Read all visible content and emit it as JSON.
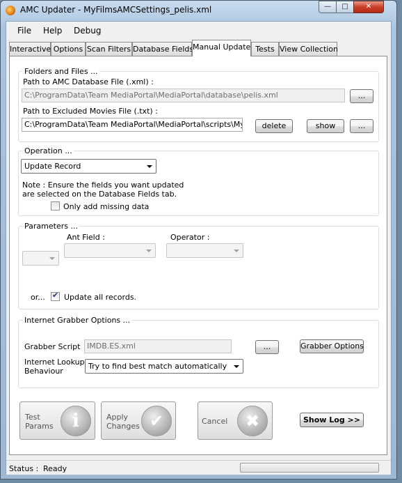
{
  "window": {
    "title": "AMC Updater - MyFilmsAMCSettings_pelis.xml",
    "controls": {
      "minimize": "—",
      "maximize": "□",
      "close": "✕"
    }
  },
  "menu": [
    "File",
    "Help",
    "Debug"
  ],
  "tabs": [
    "Interactive",
    "Options",
    "Scan Filters",
    "Database Fields",
    "Manual Update",
    "Tests",
    "View Collection"
  ],
  "active_tab": "Manual Update",
  "folders": {
    "title": "Folders and Files ...",
    "db_label": "Path to AMC Database File (.xml) :",
    "db_value": "C:\\ProgramData\\Team MediaPortal\\MediaPortal\\database\\pelis.xml",
    "db_browse": "...",
    "excluded_label": "Path to Excluded Movies File (.txt) :",
    "excluded_value": "C:\\ProgramData\\Team MediaPortal\\MediaPortal\\scripts\\MyFilms\\",
    "delete": "delete",
    "show": "show",
    "excluded_browse": "..."
  },
  "operation": {
    "title": "Operation ...",
    "selected": "Update Record",
    "note_line1": "Note : Ensure the fields you want updated",
    "note_line2": "are selected on the Database Fields tab.",
    "only_missing_label": "Only add missing data",
    "only_missing_checked": false
  },
  "parameters": {
    "title": "Parameters ...",
    "ant_field_label": "Ant Field :",
    "operator_label": "Operator :",
    "or_label": "or...",
    "update_all_label": "Update all records.",
    "update_all_checked": true
  },
  "grabber": {
    "title": "Internet Grabber Options ...",
    "script_label": "Grabber Script",
    "script_value": "IMDB.ES.xml",
    "browse": "...",
    "options_button": "Grabber Options",
    "lookup_label_line1": "Internet Lookup",
    "lookup_label_line2": "Behaviour",
    "lookup_value": "Try to find best match automatically"
  },
  "actions": {
    "test_line1": "Test",
    "test_line2": "Params",
    "test_glyph": "i",
    "apply_line1": "Apply",
    "apply_line2": "Changes",
    "apply_glyph": "✔",
    "cancel": "Cancel",
    "cancel_glyph": "✖",
    "show_log": "Show Log >>"
  },
  "status": {
    "label": "Status :",
    "value": "Ready",
    "progress": 0
  }
}
